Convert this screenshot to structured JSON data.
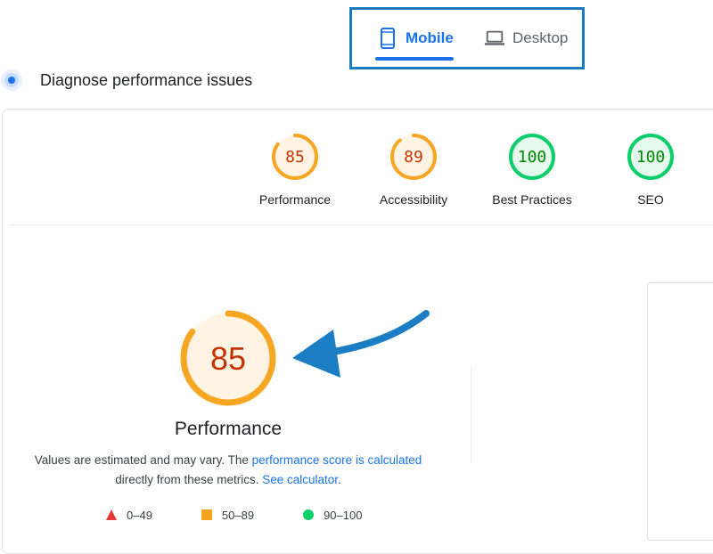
{
  "device_tabs": [
    {
      "label": "Mobile",
      "icon": "smartphone-icon",
      "selected": true
    },
    {
      "label": "Desktop",
      "icon": "laptop-icon",
      "selected": false
    }
  ],
  "header": {
    "title": "Diagnose performance issues"
  },
  "scores": [
    {
      "label": "Performance",
      "value": "85",
      "fraction": 0.85,
      "status": "average"
    },
    {
      "label": "Accessibility",
      "value": "89",
      "fraction": 0.89,
      "status": "average"
    },
    {
      "label": "Best Practices",
      "value": "100",
      "fraction": 1.0,
      "status": "pass"
    },
    {
      "label": "SEO",
      "value": "100",
      "fraction": 1.0,
      "status": "pass"
    }
  ],
  "featured": {
    "label": "Performance",
    "value": "85",
    "fraction": 0.85
  },
  "description": {
    "text1": "Values are estimated and may vary. The ",
    "link1": "performance score is calculated",
    "text2": " directly from these metrics. ",
    "link2": "See calculator",
    "text3": "."
  },
  "legend": [
    {
      "range": "0–49",
      "shape": "triangle",
      "color": "#e53935"
    },
    {
      "range": "50–89",
      "shape": "square",
      "color": "#f6a21c"
    },
    {
      "range": "90–100",
      "shape": "circle",
      "color": "#0cce6b"
    }
  ],
  "colors": {
    "accent": "#1a73e8",
    "highlight_border": "#1a7bbf",
    "average_ring": "#f6a623",
    "average_text": "#c33300",
    "average_bg": "#fff3e3",
    "pass_ring": "#0cce6b",
    "pass_text": "#008800",
    "pass_bg": "#e6f9ee",
    "arrow": "#1b7dc4"
  }
}
